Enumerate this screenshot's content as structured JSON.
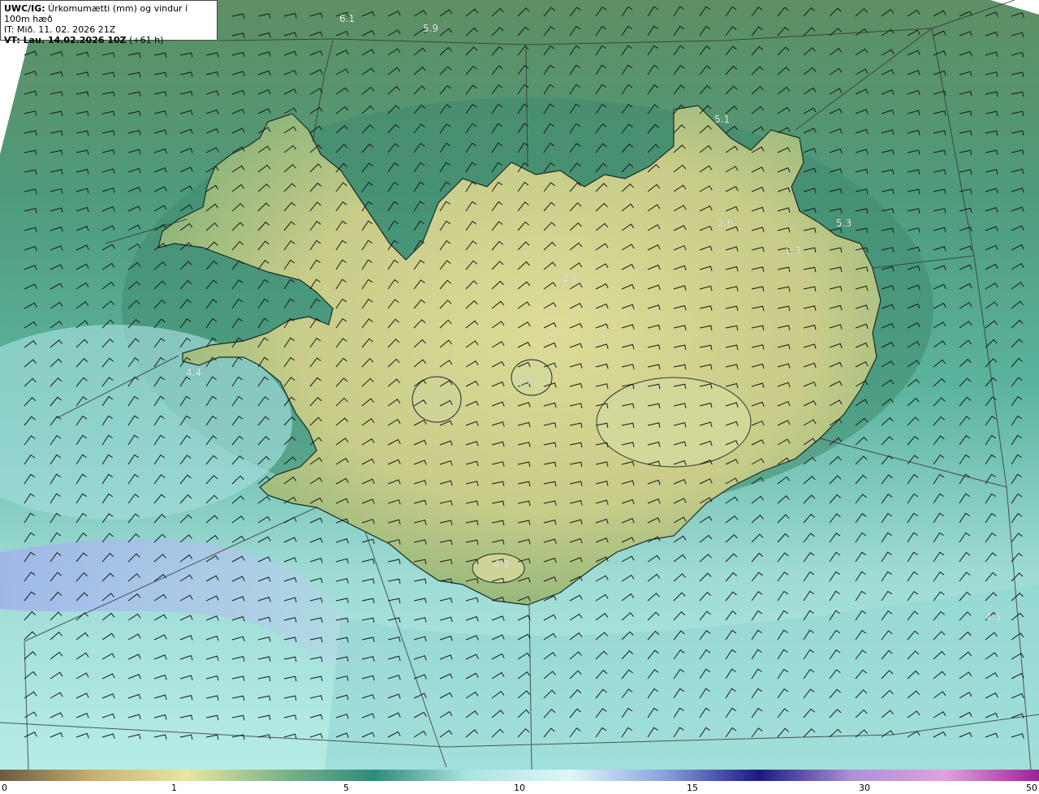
{
  "header": {
    "model": "UWC/IG:",
    "title": " Úrkomumætti (mm) og vindur í 100m hæð",
    "initial_time": "IT: Mið. 11. 02. 2026 21Z",
    "valid_prefix": "VT: Lau. 14.02.2026 10Z",
    "valid_suffix": " (+61 h)"
  },
  "value_labels": [
    "6.1",
    "5.9",
    "5.1",
    "5.3",
    "2.6",
    "2.3",
    "4.3",
    "2.7",
    "4.4",
    "4.5",
    "4.0",
    "4.5"
  ],
  "colorbar": {
    "ticks": [
      "0",
      "1",
      "5",
      "10",
      "15",
      "30",
      "50"
    ],
    "colors": [
      "#6b5a40",
      "#c8b070",
      "#e8e6a0",
      "#7fb58a",
      "#2f8a7a",
      "#a9e4e0",
      "#e0f5f8",
      "#8aa0e0",
      "#1a1a80",
      "#b090d8",
      "#e0a0e0",
      "#a02098"
    ]
  },
  "colors": {
    "land": "#d8d690",
    "sea_green": "#3f8e74",
    "shallow": "#a8e0dc",
    "band": "#a9b8ea"
  }
}
